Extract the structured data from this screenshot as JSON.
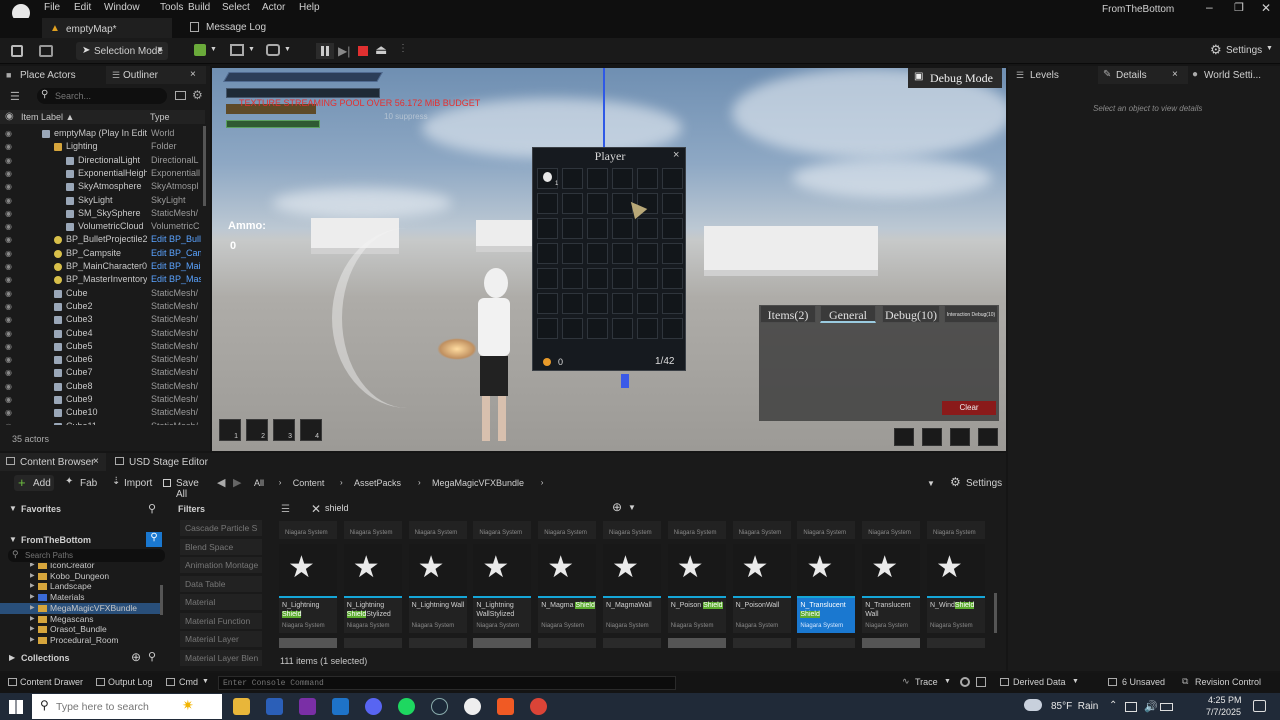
{
  "menu": [
    "File",
    "Edit",
    "Window",
    "Tools",
    "Build",
    "Select",
    "Actor",
    "Help"
  ],
  "project_name": "FromTheBottom",
  "tabs": {
    "map": "emptyMap*",
    "log": "Message Log"
  },
  "toolbar": {
    "mode": "Selection Mode",
    "settings": "Settings"
  },
  "outliner": {
    "tab_place": "Place Actors",
    "tab_outliner": "Outliner",
    "search_placeholder": "Search...",
    "col_label": "Item Label ▲",
    "col_type": "Type",
    "rows": [
      {
        "label": "emptyMap (Play In Editor)",
        "type": "World",
        "indent": 0,
        "link": false
      },
      {
        "label": "Lighting",
        "type": "Folder",
        "indent": 1,
        "link": false
      },
      {
        "label": "DirectionalLight",
        "type": "DirectionalL",
        "indent": 2,
        "link": false
      },
      {
        "label": "ExponentialHeightFog",
        "type": "Exponentiall",
        "indent": 2,
        "link": false
      },
      {
        "label": "SkyAtmosphere",
        "type": "SkyAtmospl",
        "indent": 2,
        "link": false
      },
      {
        "label": "SkyLight",
        "type": "SkyLight",
        "indent": 2,
        "link": false
      },
      {
        "label": "SM_SkySphere",
        "type": "StaticMesh/",
        "indent": 2,
        "link": false
      },
      {
        "label": "VolumetricCloud",
        "type": "VolumetricC",
        "indent": 2,
        "link": false
      },
      {
        "label": "BP_BulletProjectile28",
        "type": "Edit BP_Bull",
        "indent": 1,
        "link": true
      },
      {
        "label": "BP_Campsite",
        "type": "Edit BP_Cam",
        "indent": 1,
        "link": true
      },
      {
        "label": "BP_MainCharacter0",
        "type": "Edit BP_Mai",
        "indent": 1,
        "link": true
      },
      {
        "label": "BP_MasterInventoryCor",
        "type": "Edit BP_Mas",
        "indent": 1,
        "link": true
      },
      {
        "label": "Cube",
        "type": "StaticMesh/",
        "indent": 1,
        "link": false
      },
      {
        "label": "Cube2",
        "type": "StaticMesh/",
        "indent": 1,
        "link": false
      },
      {
        "label": "Cube3",
        "type": "StaticMesh/",
        "indent": 1,
        "link": false
      },
      {
        "label": "Cube4",
        "type": "StaticMesh/",
        "indent": 1,
        "link": false
      },
      {
        "label": "Cube5",
        "type": "StaticMesh/",
        "indent": 1,
        "link": false
      },
      {
        "label": "Cube6",
        "type": "StaticMesh/",
        "indent": 1,
        "link": false
      },
      {
        "label": "Cube7",
        "type": "StaticMesh/",
        "indent": 1,
        "link": false
      },
      {
        "label": "Cube8",
        "type": "StaticMesh/",
        "indent": 1,
        "link": false
      },
      {
        "label": "Cube9",
        "type": "StaticMesh/",
        "indent": 1,
        "link": false
      },
      {
        "label": "Cube10",
        "type": "StaticMesh/",
        "indent": 1,
        "link": false
      },
      {
        "label": "Cube11",
        "type": "StaticMesh/",
        "indent": 1,
        "link": false
      }
    ],
    "actor_count": "35 actors"
  },
  "viewport": {
    "debug_mode": "Debug Mode",
    "warning": "TEXTURE STREAMING POOL OVER 56.172 MiB BUDGET",
    "hint": "10 suppress",
    "ammo_label": "Ammo:",
    "ammo_value": "0",
    "inventory": {
      "title": "Player",
      "close": "×",
      "slot1_count": "1",
      "gold": "0",
      "capacity": "1/42"
    },
    "debug_tabs": [
      "Items(2)",
      "General",
      "Debug(10)",
      "Interaction Debug(10)"
    ],
    "clear_label": "Clear",
    "hotbar": [
      "1",
      "2",
      "3",
      "4"
    ]
  },
  "right_tabs": {
    "levels": "Levels",
    "details": "Details",
    "world": "World Setti..."
  },
  "details_hint": "Select an object to view details",
  "content_browser": {
    "tab": "Content Browser",
    "usd_tab": "USD Stage Editor",
    "add": "Add",
    "fab": "Fab",
    "import": "Import",
    "save_all": "Save All",
    "breadcrumb": [
      "All",
      "Content",
      "AssetPacks",
      "MegaMagicVFXBundle"
    ],
    "settings": "Settings",
    "favorites": "Favorites",
    "project": "FromTheBottom",
    "search_paths": "Search Paths",
    "folders": [
      "IconCreator",
      "Kobo_Dungeon",
      "Landscape",
      "Materials",
      "MegaMagicVFXBundle",
      "Megascans",
      "Orasot_Bundle",
      "Procedural_Room"
    ],
    "collections": "Collections",
    "filters_title": "Filters",
    "filters": [
      "Cascade Particle S",
      "Blend Space",
      "Animation Montage",
      "Data Table",
      "Material",
      "Material Function",
      "Material Layer",
      "Material Layer Blen"
    ],
    "search_value": "shield",
    "assets": [
      {
        "name": "N_Lightning ",
        "hl": "Shield",
        "after": "",
        "sub": "Niagara System"
      },
      {
        "name": "N_Lightning ",
        "hl": "Shield",
        "after": "Stylized",
        "sub": "Niagara System"
      },
      {
        "name": "N_Lightning Wall",
        "hl": "",
        "after": "",
        "sub": "Niagara System"
      },
      {
        "name": "N_Lightning WallStylized",
        "hl": "",
        "after": "",
        "sub": "Niagara System"
      },
      {
        "name": "N_Magma ",
        "hl": "Shield",
        "after": "",
        "sub": "Niagara System"
      },
      {
        "name": "N_MagmaWall",
        "hl": "",
        "after": "",
        "sub": "Niagara System"
      },
      {
        "name": "N_Poison ",
        "hl": "Shield",
        "after": "",
        "sub": "Niagara System"
      },
      {
        "name": "N_PoisonWall",
        "hl": "",
        "after": "",
        "sub": "Niagara System"
      },
      {
        "name": "N_Translucent ",
        "hl": "Shield",
        "after": "",
        "sub": "Niagara System"
      },
      {
        "name": "N_Translucent Wall",
        "hl": "",
        "after": "",
        "sub": "Niagara System"
      },
      {
        "name": "N_Wind",
        "hl": "Shield",
        "after": "",
        "sub": "Niagara System"
      }
    ],
    "item_count": "111 items (1 selected)"
  },
  "statusbar": {
    "content_drawer": "Content Drawer",
    "output_log": "Output Log",
    "cmd": "Cmd",
    "console_placeholder": "Enter Console Command",
    "trace": "Trace",
    "derived": "Derived Data",
    "unsaved": "6 Unsaved",
    "revision": "Revision Control"
  },
  "taskbar": {
    "search_placeholder": "Type here to search",
    "weather": "85°F  Rain",
    "time": "4:25 PM",
    "date": "7/7/2025"
  }
}
